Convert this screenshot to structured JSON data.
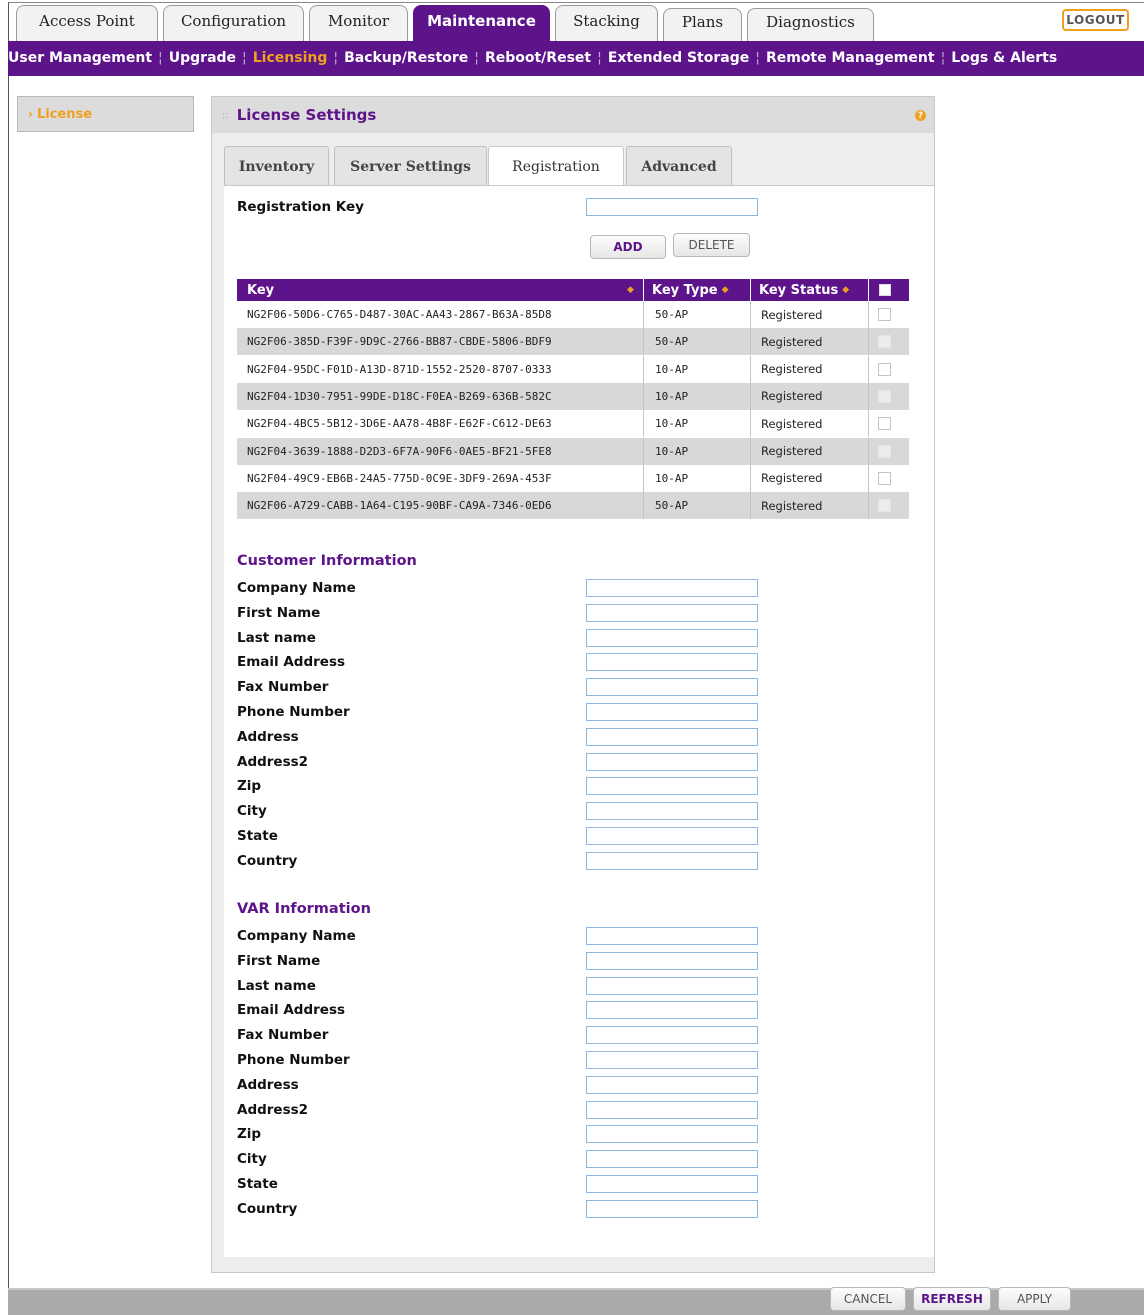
{
  "main_tabs": [
    {
      "label": "Access Point"
    },
    {
      "label": "Configuration"
    },
    {
      "label": "Monitor"
    },
    {
      "label": "Maintenance"
    },
    {
      "label": "Stacking"
    },
    {
      "label": "Plans"
    },
    {
      "label": "Diagnostics"
    }
  ],
  "logout_label": "LOGOUT",
  "sub_nav": [
    {
      "label": "User Management"
    },
    {
      "label": "Upgrade"
    },
    {
      "label": "Licensing"
    },
    {
      "label": "Backup/Restore"
    },
    {
      "label": "Reboot/Reset"
    },
    {
      "label": "Extended Storage"
    },
    {
      "label": "Remote Management"
    },
    {
      "label": "Logs & Alerts"
    }
  ],
  "side_menu": {
    "item_label": "License"
  },
  "panel": {
    "title": "License Settings",
    "help_glyph": "?"
  },
  "sub_tabs": [
    {
      "label": "Inventory"
    },
    {
      "label": "Server Settings"
    },
    {
      "label": "Registration"
    },
    {
      "label": "Advanced"
    }
  ],
  "registration": {
    "key_label": "Registration Key",
    "key_value": "",
    "add_label": "ADD",
    "delete_label": "DELETE"
  },
  "key_table": {
    "columns": [
      "Key",
      "Key Type",
      "Key Status"
    ],
    "rows": [
      {
        "key": "NG2F06-50D6-C765-D487-30AC-AA43-2867-B63A-85D8",
        "type": "50-AP",
        "status": "Registered"
      },
      {
        "key": "NG2F06-385D-F39F-9D9C-2766-BB87-CBDE-5806-BDF9",
        "type": "50-AP",
        "status": "Registered"
      },
      {
        "key": "NG2F04-95DC-F01D-A13D-871D-1552-2520-8707-0333",
        "type": "10-AP",
        "status": "Registered"
      },
      {
        "key": "NG2F04-1D30-7951-99DE-D18C-F0EA-B269-636B-582C",
        "type": "10-AP",
        "status": "Registered"
      },
      {
        "key": "NG2F04-4BC5-5B12-3D6E-AA78-4B8F-E62F-C612-DE63",
        "type": "10-AP",
        "status": "Registered"
      },
      {
        "key": "NG2F04-3639-1888-D2D3-6F7A-90F6-0AE5-BF21-5FE8",
        "type": "10-AP",
        "status": "Registered"
      },
      {
        "key": "NG2F04-49C9-EB6B-24A5-775D-0C9E-3DF9-269A-453F",
        "type": "10-AP",
        "status": "Registered"
      },
      {
        "key": "NG2F06-A729-CABB-1A64-C195-90BF-CA9A-7346-0ED6",
        "type": "50-AP",
        "status": "Registered"
      }
    ]
  },
  "customer_info": {
    "title": "Customer Information",
    "fields": [
      "Company Name",
      "First Name",
      "Last name",
      "Email Address",
      "Fax Number",
      "Phone Number",
      "Address",
      "Address2",
      "Zip",
      "City",
      "State",
      "Country"
    ]
  },
  "var_info": {
    "title": "VAR Information",
    "fields": [
      "Company Name",
      "First Name",
      "Last name",
      "Email Address",
      "Fax Number",
      "Phone Number",
      "Address",
      "Address2",
      "Zip",
      "City",
      "State",
      "Country"
    ]
  },
  "footer": {
    "cancel_label": "CANCEL",
    "refresh_label": "REFRESH",
    "apply_label": "APPLY"
  },
  "colors": {
    "brand_purple": "#5d148a",
    "accent_orange": "#f0a020",
    "input_border": "#8fb8de"
  }
}
